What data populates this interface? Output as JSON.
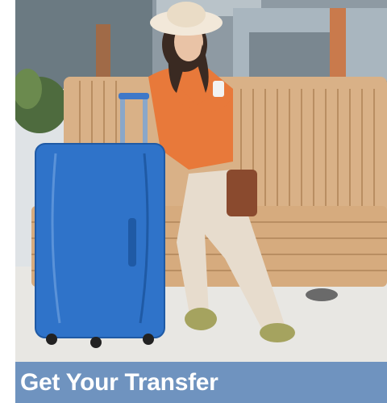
{
  "card": {
    "title": "Get Your Transfer",
    "photo_icon": "traveler-with-suitcase-photo",
    "caption_bar_color": "#6f93bf"
  }
}
